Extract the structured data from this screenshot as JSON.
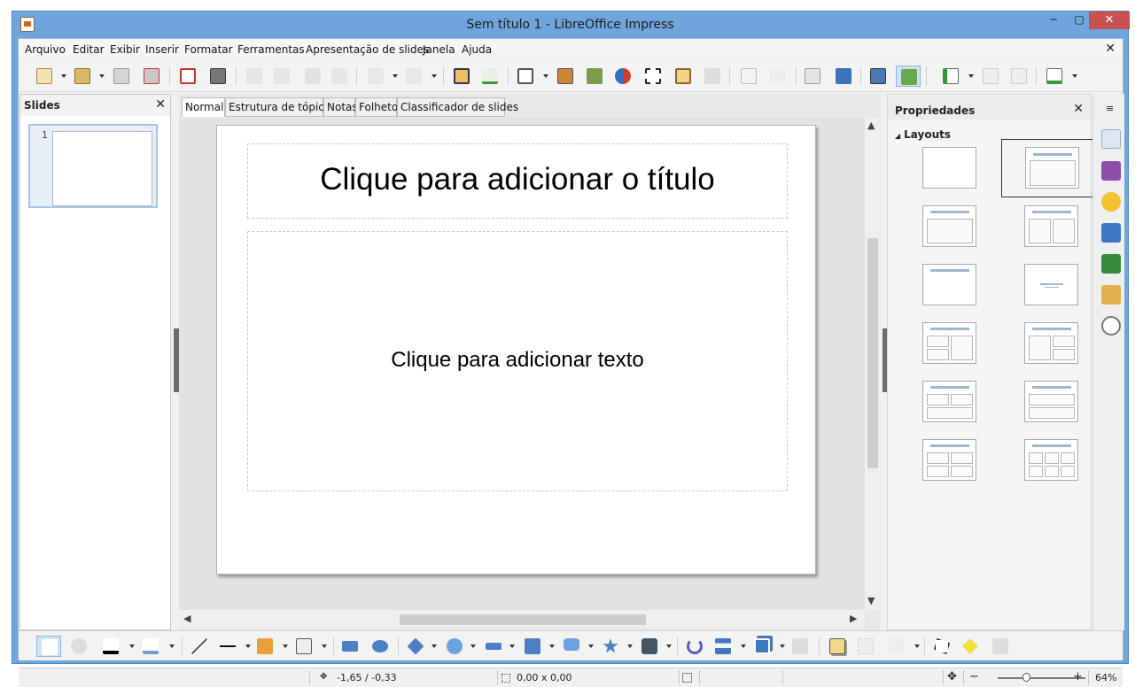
{
  "window": {
    "title": "Sem título 1 - LibreOffice Impress",
    "minimize": "─",
    "maximize": "▢",
    "close": "✕"
  },
  "menu": [
    "Arquivo",
    "Editar",
    "Exibir",
    "Inserir",
    "Formatar",
    "Ferramentas",
    "Apresentação de slides",
    "Janela",
    "Ajuda"
  ],
  "doc_close": "✕",
  "slides_pane": {
    "title": "Slides",
    "close": "✕",
    "thumb_number": "1"
  },
  "view_tabs": [
    "Normal",
    "Estrutura de tópicos",
    "Notas",
    "Folheto",
    "Classificador de slides"
  ],
  "slide": {
    "title_placeholder": "Clique para adicionar o título",
    "body_placeholder": "Clique para adicionar texto"
  },
  "properties": {
    "title": "Propriedades",
    "close": "✕",
    "section": "Layouts",
    "section_arrow": "◢"
  },
  "status": {
    "position": "-1,65 / -0,33",
    "size": "0,00 x 0,00",
    "zoom_minus": "−",
    "zoom_plus": "+",
    "zoom": "64%",
    "move_icon": "✥"
  },
  "deck": {
    "menu": "≡"
  },
  "scroll": {
    "up": "▲",
    "down": "▼",
    "left": "◀",
    "right": "▶"
  },
  "colors": {
    "title_bar": "#6fa4dc",
    "close_button": "#c75050",
    "selection": "#a8c3e4"
  }
}
